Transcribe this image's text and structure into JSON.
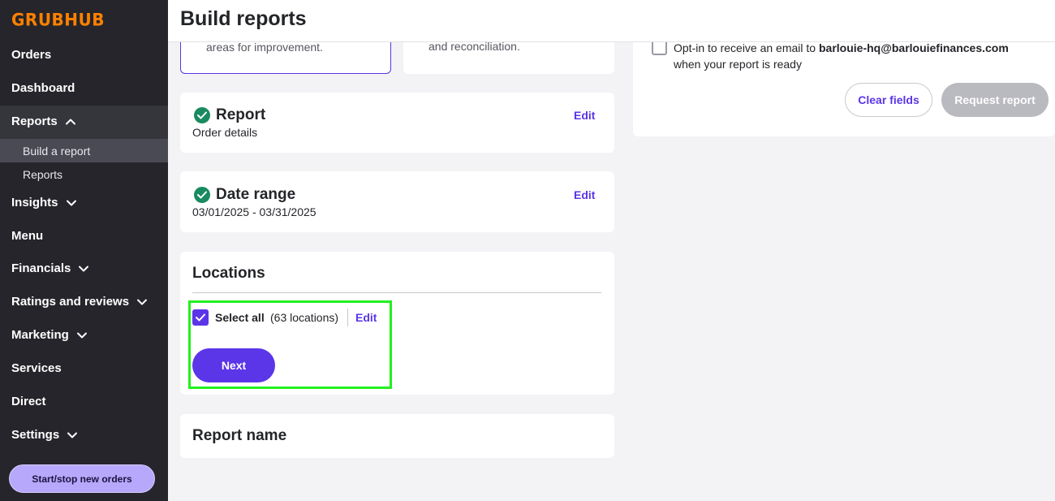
{
  "brand": {
    "logo": "GRUBHUB",
    "accent": "#ff8000",
    "primary": "#5b35e8"
  },
  "sidebar": {
    "items": [
      {
        "label": "Orders"
      },
      {
        "label": "Dashboard"
      },
      {
        "label": "Reports",
        "expanded": true
      },
      {
        "label": "Insights"
      },
      {
        "label": "Menu"
      },
      {
        "label": "Financials"
      },
      {
        "label": "Ratings and reviews"
      },
      {
        "label": "Marketing"
      },
      {
        "label": "Services"
      },
      {
        "label": "Direct"
      },
      {
        "label": "Settings"
      }
    ],
    "subitems": [
      {
        "label": "Build a report",
        "active": true
      },
      {
        "label": "Reports"
      }
    ],
    "start_stop_label": "Start/stop new orders"
  },
  "header": {
    "title": "Build reports"
  },
  "top_cards": [
    {
      "text": "areas for improvement."
    },
    {
      "text": "and reconciliation."
    }
  ],
  "report_card": {
    "title": "Report",
    "value": "Order details",
    "edit": "Edit"
  },
  "date_card": {
    "title": "Date range",
    "value": "03/01/2025 - 03/31/2025",
    "edit": "Edit"
  },
  "locations_card": {
    "title": "Locations",
    "select_all": "Select all",
    "count": "(63 locations)",
    "edit": "Edit",
    "next": "Next",
    "checked": true
  },
  "report_name_card": {
    "title": "Report name"
  },
  "right_panel": {
    "optin_prefix": "Opt-in to receive an email to",
    "optin_email": "barlouie-hq@barlouiefinances.com",
    "optin_suffix": "when your report is ready",
    "clear_label": "Clear fields",
    "request_label": "Request report"
  }
}
